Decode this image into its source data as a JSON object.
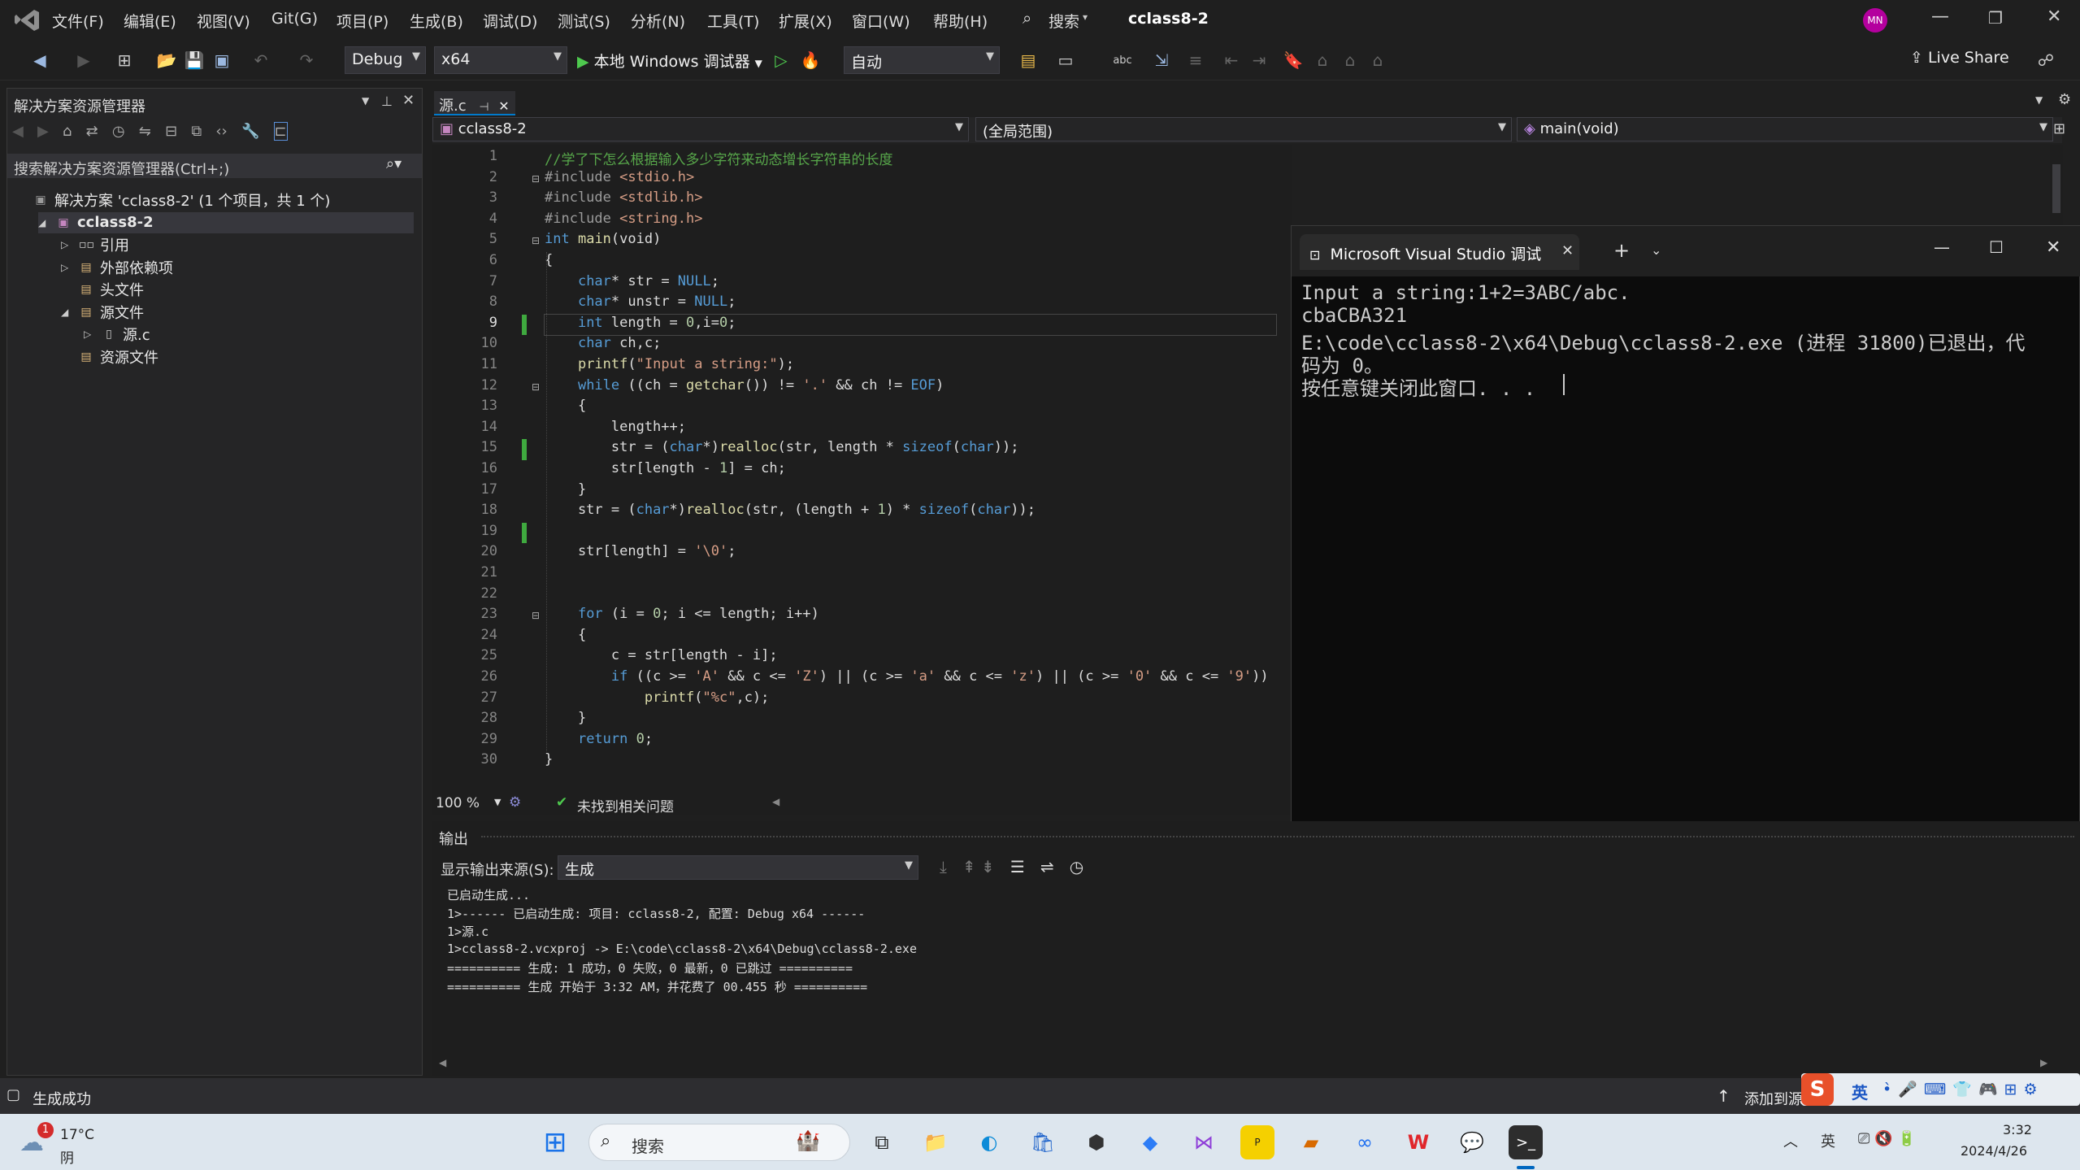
{
  "menu": {
    "items": [
      "文件(F)",
      "编辑(E)",
      "视图(V)",
      "Git(G)",
      "项目(P)",
      "生成(B)",
      "调试(D)",
      "测试(S)",
      "分析(N)",
      "工具(T)",
      "扩展(X)",
      "窗口(W)",
      "帮助(H)"
    ],
    "search_label": "搜索",
    "solution_name": "cclass8-2",
    "avatar": "MN"
  },
  "toolbar": {
    "config": "Debug",
    "platform": "x64",
    "debugger": "本地 Windows 调试器",
    "auto": "自动",
    "live_share": "Live Share"
  },
  "solution_explorer": {
    "title": "解决方案资源管理器",
    "search_placeholder": "搜索解决方案资源管理器(Ctrl+;)",
    "tree": [
      {
        "label": "解决方案 'cclass8-2' (1 个项目，共 1 个)",
        "indent": 0,
        "icon": "solution-icon",
        "expander": ""
      },
      {
        "label": "cclass8-2",
        "indent": 1,
        "icon": "project-icon",
        "expander": "◢",
        "bold": true
      },
      {
        "label": "引用",
        "indent": 2,
        "icon": "reference-icon",
        "expander": "▷"
      },
      {
        "label": "外部依赖项",
        "indent": 2,
        "icon": "folder-icon",
        "expander": "▷"
      },
      {
        "label": "头文件",
        "indent": 2,
        "icon": "folder-icon",
        "expander": ""
      },
      {
        "label": "源文件",
        "indent": 2,
        "icon": "folder-icon",
        "expander": "◢"
      },
      {
        "label": "源.c",
        "indent": 3,
        "icon": "c-file-icon",
        "expander": "▷"
      },
      {
        "label": "资源文件",
        "indent": 2,
        "icon": "folder-icon",
        "expander": ""
      }
    ]
  },
  "editor": {
    "tab": "源.c",
    "project_combo": "cclass8-2",
    "scope_combo": "(全局范围)",
    "member_combo": "main(void)",
    "zoom": "100 %",
    "issues": "未找到相关问题",
    "lines": [
      "//学了下怎么根据输入多少字符来动态增长字符串的长度",
      "#include <stdio.h>",
      "#include <stdlib.h>",
      "#include <string.h>",
      "int main(void)",
      "{",
      "    char* str = NULL;",
      "    char* unstr = NULL;",
      "    int length = 0,i=0;",
      "    char ch,c;",
      "    printf(\"Input a string:\");",
      "    while ((ch = getchar()) != '.' && ch != EOF)",
      "    {",
      "        length++;",
      "        str = (char*)realloc(str, length * sizeof(char));",
      "        str[length - 1] = ch;",
      "    }",
      "    str = (char*)realloc(str, (length + 1) * sizeof(char));",
      "",
      "    str[length] = '\\0';",
      "",
      "",
      "    for (i = 0; i <= length; i++)",
      "    {",
      "        c = str[length - i];",
      "        if ((c >= 'A' && c <= 'Z') || (c >= 'a' && c <= 'z') || (c >= '0' && c <= '9'))",
      "            printf(\"%c\",c);",
      "    }",
      "    return 0;",
      "}"
    ]
  },
  "console": {
    "title": "Microsoft Visual Studio 调试",
    "lines": [
      "Input a string:1+2=3ABC/abc.",
      "cbaCBA321",
      "E:\\code\\cclass8-2\\x64\\Debug\\cclass8-2.exe (进程 31800)已退出，代",
      "码为 0。",
      "按任意键关闭此窗口. . ."
    ]
  },
  "output": {
    "title": "输出",
    "source_label": "显示输出来源(S):",
    "source_value": "生成",
    "lines": [
      "已启动生成...",
      "1>------ 已启动生成: 项目: cclass8-2, 配置: Debug x64 ------",
      "1>源.c",
      "1>cclass8-2.vcxproj -> E:\\code\\cclass8-2\\x64\\Debug\\cclass8-2.exe",
      "========== 生成: 1 成功，0 失败，0 最新，0 已跳过 ==========",
      "========== 生成 开始于 3:32 AM，并花费了 00.455 秒 =========="
    ]
  },
  "status": {
    "text": "生成成功",
    "add_source": "添加到源",
    "ime": "英"
  },
  "taskbar": {
    "weather_temp": "17°C",
    "weather_desc": "阴",
    "weather_badge": "1",
    "search": "搜索",
    "time": "3:32",
    "date": "2024/4/26"
  },
  "colors": {
    "accent": "#68217a",
    "console_bg": "#0c0c0c",
    "editor_bg": "#1e1e1e",
    "taskbar_bg": "#dde6ee"
  }
}
